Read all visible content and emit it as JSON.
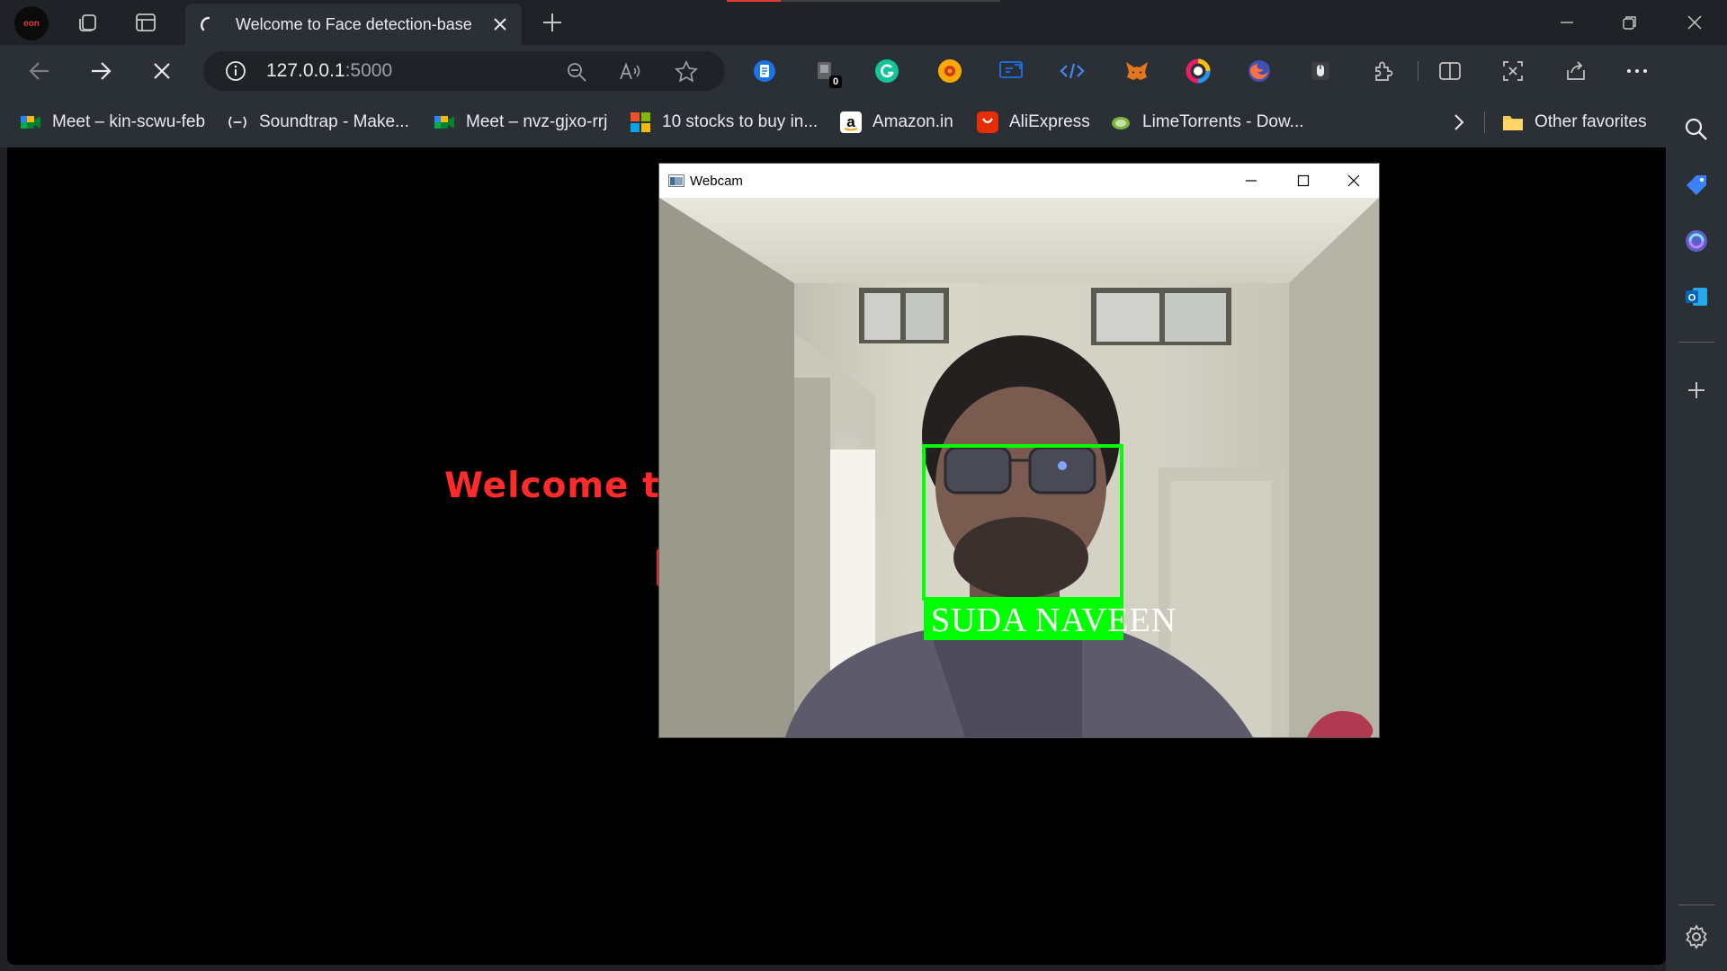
{
  "browser": {
    "profile_label": "eon",
    "tab": {
      "title": "Welcome to Face detection-base"
    },
    "address": {
      "host": "127.0.0.1",
      "port": ":5000"
    }
  },
  "bookmarks": [
    {
      "label": "Meet – kin-scwu-feb",
      "icon": "google-meet-icon"
    },
    {
      "label": "Soundtrap - Make...",
      "icon": "soundtrap-icon"
    },
    {
      "label": "Meet – nvz-gjxo-rrj",
      "icon": "google-meet-icon"
    },
    {
      "label": "10 stocks to buy in...",
      "icon": "microsoft-icon"
    },
    {
      "label": "Amazon.in",
      "icon": "amazon-icon"
    },
    {
      "label": "AliExpress",
      "icon": "aliexpress-icon"
    },
    {
      "label": "LimeTorrents - Dow...",
      "icon": "limetorrents-icon"
    }
  ],
  "other_favorites": "Other favorites",
  "extensions": {
    "badge_count": "0"
  },
  "page": {
    "welcome_text": "Welcome to F"
  },
  "webcam": {
    "window_title": "Webcam",
    "detected_name": "SUDA NAVEEN"
  },
  "colors": {
    "accent_red": "#ff2a2a",
    "detection_box": "#00ff00",
    "browser_bg": "#2b3036"
  }
}
